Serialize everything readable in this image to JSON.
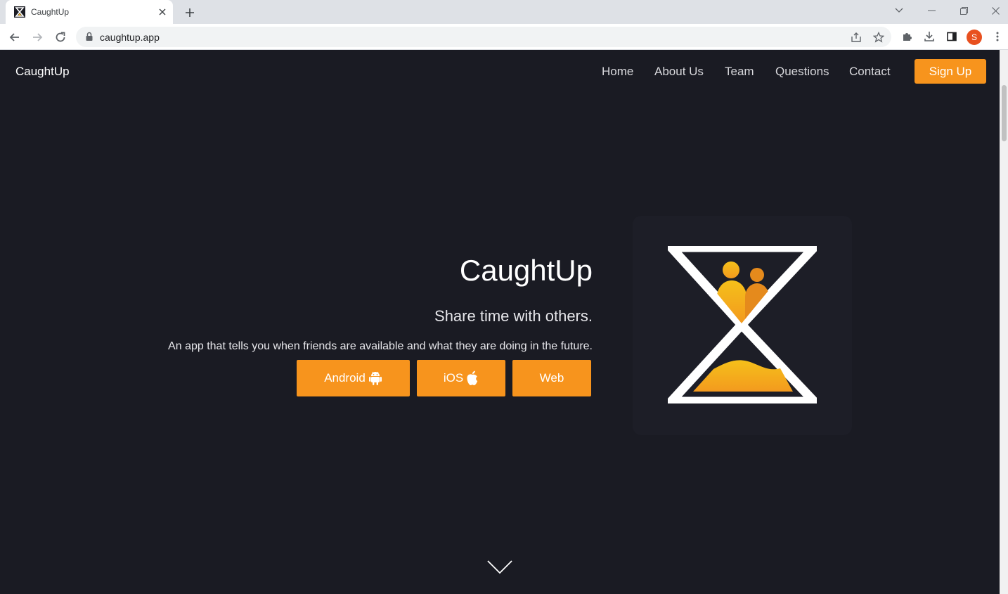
{
  "browser": {
    "tab_title": "CaughtUp",
    "url": "caughtup.app",
    "profile_initial": "S"
  },
  "nav": {
    "brand": "CaughtUp",
    "links": [
      "Home",
      "About Us",
      "Team",
      "Questions",
      "Contact"
    ],
    "signup_label": "Sign Up"
  },
  "hero": {
    "title": "CaughtUp",
    "subtitle": "Share time with others.",
    "description": "An app that tells you when friends are available and what they are doing in the future.",
    "buttons": {
      "android": "Android",
      "ios": "iOS",
      "web": "Web"
    }
  },
  "colors": {
    "accent": "#f7941d",
    "background": "#1a1b23",
    "logo_gradient_top": "#f5c01a",
    "logo_gradient_bottom": "#f39a1e"
  },
  "icons": [
    "android-icon",
    "apple-icon",
    "hourglass-logo",
    "chevron-down-icon"
  ]
}
